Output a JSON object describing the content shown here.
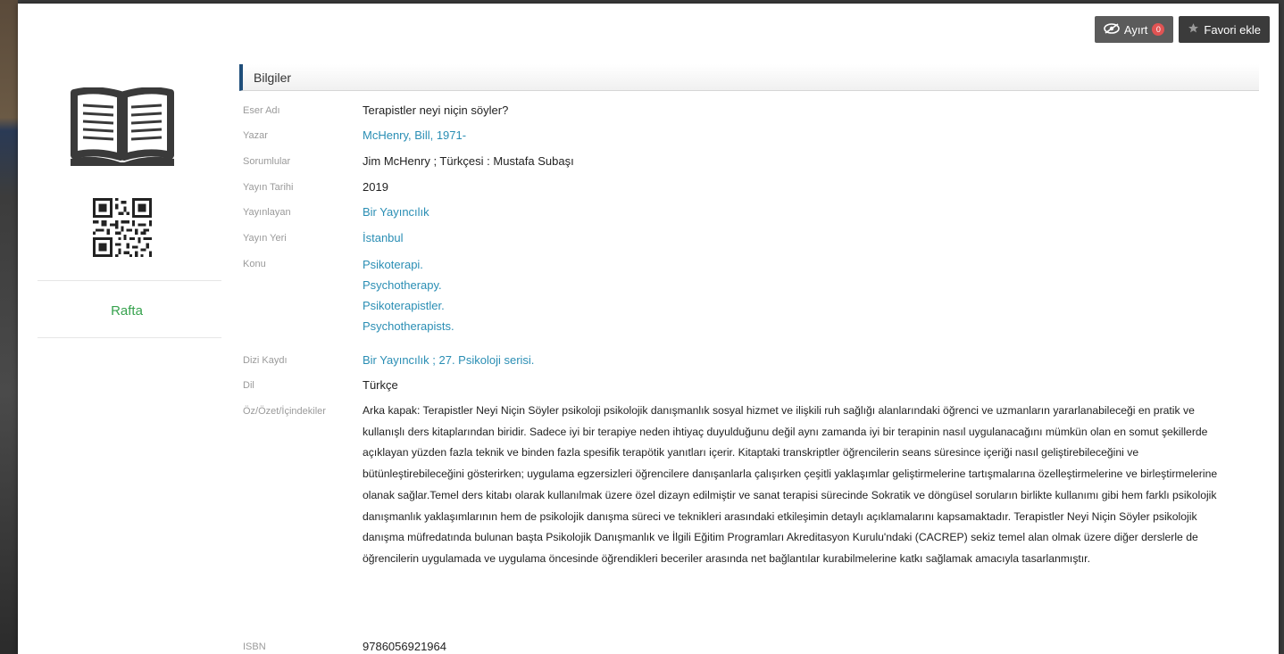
{
  "toolbar": {
    "ayirt_label": "Ayırt",
    "ayirt_count": "0",
    "favori_label": "Favori ekle"
  },
  "left": {
    "availability": "Rafta"
  },
  "section": {
    "title": "Bilgiler"
  },
  "fields": {
    "title_label": "Eser Adı",
    "title_value": "Terapistler neyi niçin söyler?",
    "author_label": "Yazar",
    "author_value": "McHenry, Bill, 1971-",
    "resp_label": "Sorumlular",
    "resp_value": "Jim McHenry ; Türkçesi : Mustafa Subaşı",
    "date_label": "Yayın Tarihi",
    "date_value": "2019",
    "publisher_label": "Yayınlayan",
    "publisher_value": "Bir Yayıncılık",
    "place_label": "Yayın Yeri",
    "place_value": "İstanbul",
    "subject_label": "Konu",
    "subjects": [
      "Psikoterapi.",
      "Psychotherapy.",
      "Psikoterapistler.",
      "Psychotherapists."
    ],
    "series_label": "Dizi Kaydı",
    "series_value": "Bir Yayıncılık ; 27. Psikoloji serisi.",
    "lang_label": "Dil",
    "lang_value": "Türkçe",
    "abstract_label": "Öz/Özet/İçindekiler",
    "abstract_value": "Arka kapak: Terapistler Neyi Niçin Söyler psikoloji psikolojik danışmanlık sosyal hizmet ve ilişkili ruh sağlığı alanlarındaki öğrenci ve uzmanların yararlanabileceği en pratik ve kullanışlı ders kitaplarından biridir. Sadece iyi bir terapiye neden ihtiyaç duyulduğunu değil aynı zamanda iyi bir terapinin nasıl uygulanacağını mümkün olan en somut şekillerde açıklayan yüzden fazla teknik ve binden fazla spesifik terapötik yanıtları içerir. Kitaptaki transkriptler öğrencilerin seans süresince içeriği nasıl geliştirebileceğini ve bütünleştirebileceğini gösterirken; uygulama egzersizleri öğrencilere danışanlarla çalışırken çeşitli yaklaşımlar geliştirmelerine tartışmalarına özelleştirmelerine ve birleştirmelerine olanak sağlar.Temel ders kitabı olarak kullanılmak üzere özel dizayn edilmiştir ve sanat terapisi sürecinde Sokratik ve döngüsel soruların birlikte kullanımı gibi hem farklı psikolojik danışmanlık yaklaşımlarının hem de psikolojik danışma süreci ve teknikleri arasındaki etkileşimin detaylı açıklamalarını kapsamaktadır. Terapistler Neyi Niçin Söyler psikolojik danışma müfredatında bulunan başta Psikolojik Danışmanlık ve İlgili Eğitim Programları Akreditasyon Kurulu'ndaki (CACREP) sekiz temel alan olmak üzere diğer derslerle de öğrencilerin uygulamada ve uygulama öncesinde öğrendikleri beceriler arasında net bağlantılar kurabilmelerine katkı sağlamak amacıyla tasarlanmıştır.",
    "isbn_label": "ISBN",
    "isbn_value": "9786056921964"
  },
  "colors": {
    "link": "#2a8eb4",
    "available": "#37a24e",
    "header_accent": "#1f4e7a"
  },
  "icons": [
    "book-icon",
    "qr-code-icon",
    "eye-slash-icon",
    "star-icon"
  ]
}
